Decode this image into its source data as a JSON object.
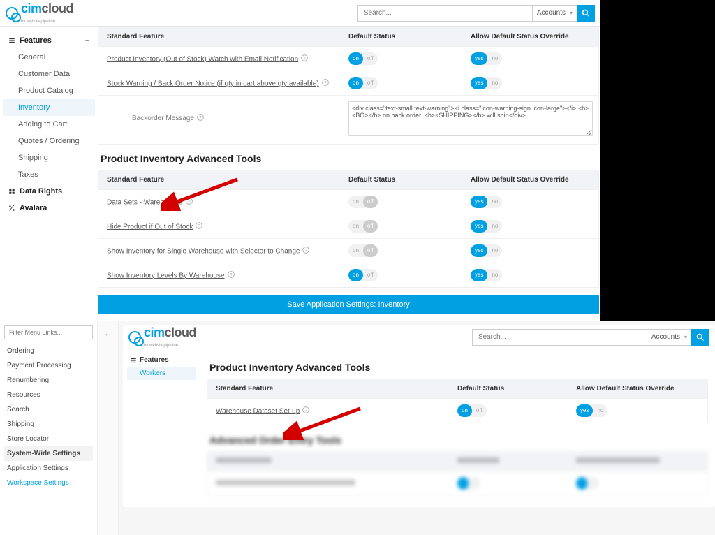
{
  "brand": {
    "part1": "cim",
    "part2": "cloud",
    "sub": "by websitepipeline"
  },
  "search": {
    "placeholder": "Search...",
    "scope": "Accounts"
  },
  "top_sidebar": {
    "group": "Features",
    "items": [
      "General",
      "Customer Data",
      "Product Catalog",
      "Inventory",
      "Adding to Cart",
      "Quotes / Ordering",
      "Shipping",
      "Taxes"
    ],
    "active_index": 3,
    "extra": [
      "Data Rights",
      "Avalara"
    ]
  },
  "top_main": {
    "table1": {
      "headers": [
        "Standard Feature",
        "Default Status",
        "Allow Default Status Override"
      ],
      "rows": [
        {
          "label": "Product Inventory (Out of Stock) Watch with Email Notification",
          "status": "on",
          "override": "yes"
        },
        {
          "label": "Stock Warning / Back Order Notice (if qty in cart above qty available)",
          "status": "on",
          "override": "yes"
        }
      ],
      "message_label": "Backorder Message",
      "message_value": "<div class=\"text-small text-warning\"><i class=\"icon-warning-sign icon-large\"></i> <b><BO></b> on back order. <b><SHIPPING></b> will ship</div>"
    },
    "section2_title": "Product Inventory Advanced Tools",
    "table2": {
      "headers": [
        "Standard Feature",
        "Default Status",
        "Allow Default Status Override"
      ],
      "rows": [
        {
          "label": "Data Sets - Warehouses",
          "status": "off",
          "override": "yes"
        },
        {
          "label": "Hide Product if Out of Stock",
          "status": "off",
          "override": "yes"
        },
        {
          "label": "Show Inventory for Single Warehouse with Selector to Change",
          "status": "off",
          "override": "yes"
        },
        {
          "label": "Show Inventory Levels By Warehouse",
          "status": "on",
          "override": "yes"
        }
      ]
    },
    "save_label": "Save Application Settings: Inventory"
  },
  "bot_filter": {
    "placeholder": "Filter Menu Links...",
    "items": [
      "Ordering",
      "Payment Processing",
      "Renumbering",
      "Resources",
      "Search",
      "Shipping",
      "Store Locator"
    ],
    "bold": "System-Wide Settings",
    "after": [
      "Application Settings",
      "Workspace Settings"
    ],
    "active_after_index": 1
  },
  "bot_side": {
    "group": "Features",
    "item": "Workers"
  },
  "bot_main": {
    "title": "Product Inventory Advanced Tools",
    "headers": [
      "Standard Feature",
      "Default Status",
      "Allow Default Status Override"
    ],
    "row": {
      "label": "Warehouse Dataset Set-up",
      "status": "on",
      "override": "yes"
    },
    "blur_title": "Advanced Order Entry Tools"
  },
  "toggle_labels": {
    "on": "on",
    "off": "off",
    "yes": "yes",
    "no": "no"
  }
}
